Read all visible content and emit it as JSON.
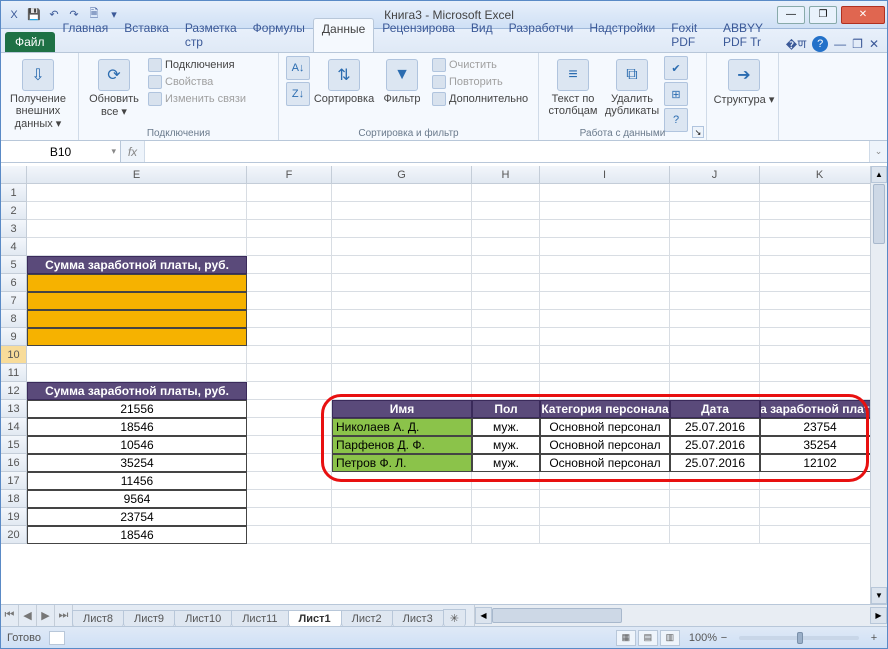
{
  "app": {
    "title": "Книга3 - Microsoft Excel"
  },
  "qat": {
    "excel": "X",
    "save": "💾",
    "undo": "↶",
    "redo": "↷",
    "print": "🗎",
    "more": "▾"
  },
  "tabs": {
    "file": "Файл",
    "items": [
      "Главная",
      "Вставка",
      "Разметка стр",
      "Формулы",
      "Данные",
      "Рецензирова",
      "Вид",
      "Разработчи",
      "Надстройки",
      "Foxit PDF",
      "ABBYY PDF Tr"
    ],
    "active_index": 4
  },
  "ribbon": {
    "g1": {
      "big": "Получение внешних данных ▾"
    },
    "g2": {
      "big": "Обновить все ▾",
      "i1": "Подключения",
      "i2": "Свойства",
      "i3": "Изменить связи",
      "label": "Подключения"
    },
    "g3": {
      "sort": "Сортировка",
      "filter": "Фильтр",
      "c1": "Очистить",
      "c2": "Повторить",
      "c3": "Дополнительно",
      "label": "Сортировка и фильтр"
    },
    "g4": {
      "b1": "Текст по столбцам",
      "b2": "Удалить дубликаты",
      "label": "Работа с данными"
    },
    "g5": {
      "big": "Структура ▾"
    }
  },
  "fbar": {
    "name": "B10",
    "fx": "fx"
  },
  "cols": [
    "E",
    "F",
    "G",
    "H",
    "I",
    "J",
    "K"
  ],
  "rows_start": 1,
  "rows_end": 20,
  "left_header": "Сумма заработной платы, руб.",
  "left_values": [
    "21556",
    "18546",
    "10546",
    "35254",
    "11456",
    "9564",
    "23754",
    "18546"
  ],
  "t2": {
    "h1": "Имя",
    "h2": "Пол",
    "h3": "Категория персонала",
    "h4": "Дата",
    "h5": "а заработной платы",
    "rows": [
      {
        "n": "Николаев А. Д.",
        "s": "муж.",
        "c": "Основной персонал",
        "d": "25.07.2016",
        "v": "23754"
      },
      {
        "n": "Парфенов Д. Ф.",
        "s": "муж.",
        "c": "Основной персонал",
        "d": "25.07.2016",
        "v": "35254"
      },
      {
        "n": "Петров Ф. Л.",
        "s": "муж.",
        "c": "Основной персонал",
        "d": "25.07.2016",
        "v": "12102"
      }
    ]
  },
  "sheets": {
    "list": [
      "Лист8",
      "Лист9",
      "Лист10",
      "Лист11",
      "Лист1",
      "Лист2",
      "Лист3"
    ],
    "active_index": 4
  },
  "status": {
    "ready": "Готово",
    "zoom": "100%"
  }
}
